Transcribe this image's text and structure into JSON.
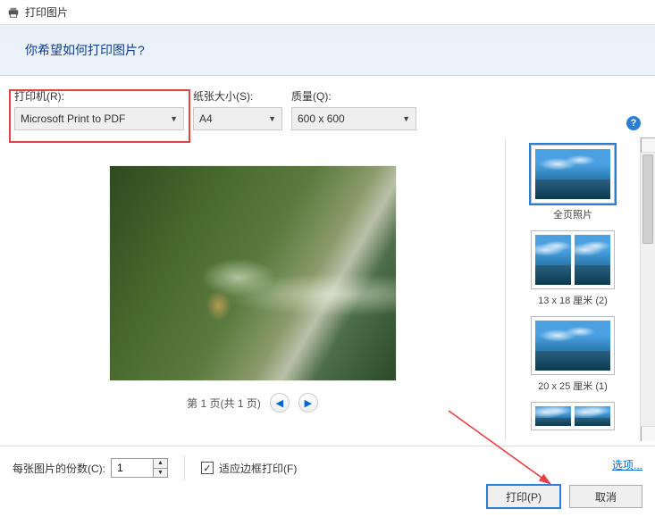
{
  "window": {
    "title": "打印图片"
  },
  "header": {
    "question": "你希望如何打印图片?"
  },
  "fields": {
    "printer": {
      "label": "打印机(R):",
      "value": "Microsoft Print to PDF"
    },
    "paper": {
      "label": "纸张大小(S):",
      "value": "A4"
    },
    "quality": {
      "label": "质量(Q):",
      "value": "600 x 600"
    }
  },
  "preview": {
    "page_text": "第 1 页(共 1 页)"
  },
  "layouts": {
    "items": [
      {
        "caption": "全页照片"
      },
      {
        "caption": "13 x 18 厘米 (2)"
      },
      {
        "caption": "20 x 25 厘米 (1)"
      },
      {
        "caption": ""
      }
    ]
  },
  "footer": {
    "copies_label": "每张图片的份数(C):",
    "copies_value": "1",
    "fit_frame_label": "适应边框打印(F)",
    "fit_frame_checked": true,
    "options_link": "选项...",
    "print_btn": "打印(P)",
    "cancel_btn": "取消"
  },
  "help": {
    "tooltip": "?"
  }
}
